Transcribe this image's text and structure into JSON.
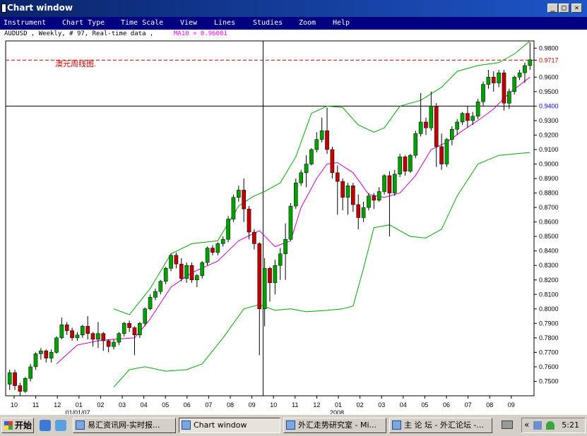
{
  "window": {
    "title": "Chart window",
    "controls": {
      "minimize": "_",
      "maximize": "□",
      "close": "✕"
    }
  },
  "menu": [
    "Instrument",
    "Chart Type",
    "Time Scale",
    "View",
    "Lines",
    "Studies",
    "Zoom",
    "Help"
  ],
  "info": {
    "instrument": "AUDUSD , Weekly, # 97, Real-time data ,",
    "ma": "MA10 = 0.96001"
  },
  "annotation": "澳元周线图.",
  "chart_data": {
    "type": "candlestick",
    "instrument": "AUDUSD",
    "period": "Weekly",
    "ylim": [
      0.74,
      0.985
    ],
    "yticks": [
      "0.9800",
      "0.9717",
      "0.9600",
      "0.9500",
      "0.9400",
      "0.9300",
      "0.9200",
      "0.9100",
      "0.9000",
      "0.8900",
      "0.8800",
      "0.8700",
      "0.8600",
      "0.8500",
      "0.8400",
      "0.8300",
      "0.8200",
      "0.8100",
      "0.8000",
      "0.7900",
      "0.7800",
      "0.7700",
      "0.7600",
      "0.7500"
    ],
    "xticks": [
      "10",
      "11",
      "12",
      "01",
      "02",
      "03",
      "04",
      "05",
      "06",
      "07",
      "08",
      "09",
      "10",
      "11",
      "12",
      "01",
      "02",
      "03",
      "04",
      "05",
      "06",
      "07",
      "08",
      "09"
    ],
    "xsub": [
      "01/01/07",
      "2008"
    ],
    "hline_black": 0.94,
    "hline_red": 0.9717,
    "cursor_x_index": 49,
    "candles": [
      [
        0.748,
        0.756,
        0.744,
        0.758
      ],
      [
        0.756,
        0.747,
        0.744,
        0.758
      ],
      [
        0.747,
        0.743,
        0.74,
        0.749
      ],
      [
        0.743,
        0.752,
        0.742,
        0.753
      ],
      [
        0.752,
        0.76,
        0.75,
        0.762
      ],
      [
        0.76,
        0.769,
        0.758,
        0.77
      ],
      [
        0.769,
        0.771,
        0.765,
        0.773
      ],
      [
        0.771,
        0.766,
        0.763,
        0.772
      ],
      [
        0.766,
        0.77,
        0.763,
        0.772
      ],
      [
        0.77,
        0.78,
        0.769,
        0.781
      ],
      [
        0.78,
        0.789,
        0.779,
        0.794
      ],
      [
        0.789,
        0.785,
        0.782,
        0.791
      ],
      [
        0.785,
        0.78,
        0.778,
        0.787
      ],
      [
        0.78,
        0.782,
        0.778,
        0.784
      ],
      [
        0.782,
        0.788,
        0.78,
        0.789
      ],
      [
        0.788,
        0.783,
        0.779,
        0.795
      ],
      [
        0.783,
        0.779,
        0.774,
        0.784
      ],
      [
        0.779,
        0.783,
        0.773,
        0.791
      ],
      [
        0.783,
        0.778,
        0.771,
        0.784
      ],
      [
        0.778,
        0.774,
        0.77,
        0.779
      ],
      [
        0.774,
        0.777,
        0.772,
        0.779
      ],
      [
        0.777,
        0.783,
        0.775,
        0.784
      ],
      [
        0.783,
        0.79,
        0.781,
        0.791
      ],
      [
        0.79,
        0.787,
        0.784,
        0.792
      ],
      [
        0.787,
        0.782,
        0.768,
        0.788
      ],
      [
        0.782,
        0.79,
        0.78,
        0.791
      ],
      [
        0.79,
        0.8,
        0.788,
        0.801
      ],
      [
        0.8,
        0.808,
        0.799,
        0.81
      ],
      [
        0.808,
        0.812,
        0.806,
        0.814
      ],
      [
        0.812,
        0.819,
        0.81,
        0.82
      ],
      [
        0.819,
        0.828,
        0.817,
        0.829
      ],
      [
        0.828,
        0.837,
        0.826,
        0.838
      ],
      [
        0.837,
        0.831,
        0.828,
        0.839
      ],
      [
        0.831,
        0.821,
        0.819,
        0.835
      ],
      [
        0.821,
        0.83,
        0.818,
        0.832
      ],
      [
        0.83,
        0.82,
        0.818,
        0.832
      ],
      [
        0.82,
        0.823,
        0.815,
        0.824
      ],
      [
        0.823,
        0.832,
        0.821,
        0.833
      ],
      [
        0.832,
        0.842,
        0.83,
        0.843
      ],
      [
        0.842,
        0.839,
        0.837,
        0.844
      ],
      [
        0.839,
        0.845,
        0.837,
        0.846
      ],
      [
        0.845,
        0.848,
        0.843,
        0.85
      ],
      [
        0.848,
        0.862,
        0.846,
        0.864
      ],
      [
        0.862,
        0.877,
        0.86,
        0.879
      ],
      [
        0.877,
        0.882,
        0.874,
        0.885
      ],
      [
        0.882,
        0.869,
        0.86,
        0.89
      ],
      [
        0.869,
        0.853,
        0.848,
        0.871
      ],
      [
        0.853,
        0.845,
        0.841,
        0.855
      ],
      [
        0.845,
        0.8,
        0.768,
        0.846
      ],
      [
        0.8,
        0.828,
        0.788,
        0.835
      ],
      [
        0.828,
        0.818,
        0.805,
        0.829
      ],
      [
        0.818,
        0.83,
        0.81,
        0.834
      ],
      [
        0.83,
        0.838,
        0.82,
        0.842
      ],
      [
        0.838,
        0.848,
        0.82,
        0.859
      ],
      [
        0.848,
        0.871,
        0.847,
        0.873
      ],
      [
        0.871,
        0.887,
        0.869,
        0.89
      ],
      [
        0.887,
        0.894,
        0.885,
        0.896
      ],
      [
        0.894,
        0.9,
        0.884,
        0.906
      ],
      [
        0.9,
        0.91,
        0.899,
        0.911
      ],
      [
        0.91,
        0.917,
        0.908,
        0.922
      ],
      [
        0.917,
        0.923,
        0.915,
        0.932
      ],
      [
        0.923,
        0.91,
        0.907,
        0.939
      ],
      [
        0.91,
        0.894,
        0.89,
        0.912
      ],
      [
        0.894,
        0.888,
        0.865,
        0.899
      ],
      [
        0.888,
        0.877,
        0.868,
        0.89
      ],
      [
        0.877,
        0.885,
        0.865,
        0.887
      ],
      [
        0.885,
        0.872,
        0.867,
        0.887
      ],
      [
        0.872,
        0.863,
        0.855,
        0.879
      ],
      [
        0.863,
        0.87,
        0.86,
        0.874
      ],
      [
        0.87,
        0.878,
        0.868,
        0.88
      ],
      [
        0.878,
        0.875,
        0.869,
        0.88
      ],
      [
        0.875,
        0.881,
        0.874,
        0.884
      ],
      [
        0.881,
        0.892,
        0.879,
        0.893
      ],
      [
        0.892,
        0.88,
        0.85,
        0.895
      ],
      [
        0.88,
        0.893,
        0.878,
        0.896
      ],
      [
        0.893,
        0.905,
        0.891,
        0.907
      ],
      [
        0.905,
        0.895,
        0.892,
        0.906
      ],
      [
        0.895,
        0.906,
        0.894,
        0.907
      ],
      [
        0.906,
        0.921,
        0.904,
        0.923
      ],
      [
        0.921,
        0.929,
        0.919,
        0.949
      ],
      [
        0.929,
        0.925,
        0.92,
        0.932
      ],
      [
        0.925,
        0.94,
        0.923,
        0.95
      ],
      [
        0.94,
        0.912,
        0.898,
        0.942
      ],
      [
        0.912,
        0.9,
        0.896,
        0.921
      ],
      [
        0.9,
        0.917,
        0.898,
        0.918
      ],
      [
        0.917,
        0.924,
        0.913,
        0.926
      ],
      [
        0.924,
        0.929,
        0.92,
        0.931
      ],
      [
        0.929,
        0.935,
        0.927,
        0.936
      ],
      [
        0.935,
        0.93,
        0.925,
        0.94
      ],
      [
        0.93,
        0.933,
        0.927,
        0.936
      ],
      [
        0.933,
        0.943,
        0.931,
        0.945
      ],
      [
        0.943,
        0.955,
        0.94,
        0.957
      ],
      [
        0.955,
        0.96,
        0.952,
        0.965
      ],
      [
        0.96,
        0.956,
        0.95,
        0.964
      ],
      [
        0.956,
        0.963,
        0.953,
        0.965
      ],
      [
        0.963,
        0.942,
        0.937,
        0.965
      ],
      [
        0.942,
        0.95,
        0.938,
        0.952
      ],
      [
        0.95,
        0.96,
        0.948,
        0.961
      ],
      [
        0.96,
        0.963,
        0.958,
        0.965
      ],
      [
        0.963,
        0.968,
        0.956,
        0.97
      ],
      [
        0.968,
        0.972,
        0.965,
        0.984
      ]
    ],
    "bb_upper": [
      [
        20,
        0.8
      ],
      [
        23,
        0.796
      ],
      [
        27,
        0.814
      ],
      [
        31,
        0.838
      ],
      [
        35,
        0.845
      ],
      [
        40,
        0.847
      ],
      [
        44,
        0.871
      ],
      [
        47,
        0.878
      ],
      [
        49,
        0.881
      ],
      [
        52,
        0.887
      ],
      [
        55,
        0.905
      ],
      [
        58,
        0.935
      ],
      [
        61,
        0.94
      ],
      [
        64,
        0.939
      ],
      [
        67,
        0.927
      ],
      [
        70,
        0.922
      ],
      [
        72,
        0.925
      ],
      [
        75,
        0.94
      ],
      [
        79,
        0.944
      ],
      [
        83,
        0.953
      ],
      [
        86,
        0.964
      ],
      [
        90,
        0.968
      ],
      [
        94,
        0.97
      ],
      [
        97,
        0.976
      ],
      [
        100,
        0.985
      ]
    ],
    "bb_lower": [
      [
        20,
        0.746
      ],
      [
        23,
        0.758
      ],
      [
        26,
        0.76
      ],
      [
        30,
        0.757
      ],
      [
        34,
        0.758
      ],
      [
        37,
        0.762
      ],
      [
        41,
        0.78
      ],
      [
        45,
        0.8
      ],
      [
        48,
        0.803
      ],
      [
        51,
        0.799
      ],
      [
        54,
        0.8
      ],
      [
        57,
        0.798
      ],
      [
        61,
        0.799
      ],
      [
        64,
        0.8
      ],
      [
        66,
        0.802
      ],
      [
        68,
        0.828
      ],
      [
        70,
        0.856
      ],
      [
        73,
        0.858
      ],
      [
        77,
        0.85
      ],
      [
        80,
        0.849
      ],
      [
        83,
        0.855
      ],
      [
        86,
        0.878
      ],
      [
        90,
        0.9
      ],
      [
        94,
        0.906
      ],
      [
        97,
        0.907
      ],
      [
        100,
        0.908
      ]
    ],
    "ma_line": [
      [
        9,
        0.762
      ],
      [
        13,
        0.775
      ],
      [
        17,
        0.778
      ],
      [
        20,
        0.779
      ],
      [
        24,
        0.78
      ],
      [
        27,
        0.793
      ],
      [
        31,
        0.815
      ],
      [
        35,
        0.825
      ],
      [
        40,
        0.833
      ],
      [
        44,
        0.847
      ],
      [
        48,
        0.854
      ],
      [
        51,
        0.843
      ],
      [
        54,
        0.847
      ],
      [
        56,
        0.87
      ],
      [
        59,
        0.89
      ],
      [
        61,
        0.9
      ],
      [
        63,
        0.901
      ],
      [
        66,
        0.894
      ],
      [
        69,
        0.879
      ],
      [
        72,
        0.877
      ],
      [
        75,
        0.88
      ],
      [
        78,
        0.892
      ],
      [
        81,
        0.91
      ],
      [
        84,
        0.915
      ],
      [
        87,
        0.923
      ],
      [
        90,
        0.93
      ],
      [
        93,
        0.938
      ],
      [
        96,
        0.949
      ],
      [
        100,
        0.96
      ]
    ]
  },
  "taskbar": {
    "start": "开始",
    "tasks": [
      "易汇资讯网-实时报...",
      "Chart window",
      "外汇走势研究室 - Mi...",
      "主 论 坛 - 外汇论坛 -..."
    ],
    "clock": "5:21"
  }
}
